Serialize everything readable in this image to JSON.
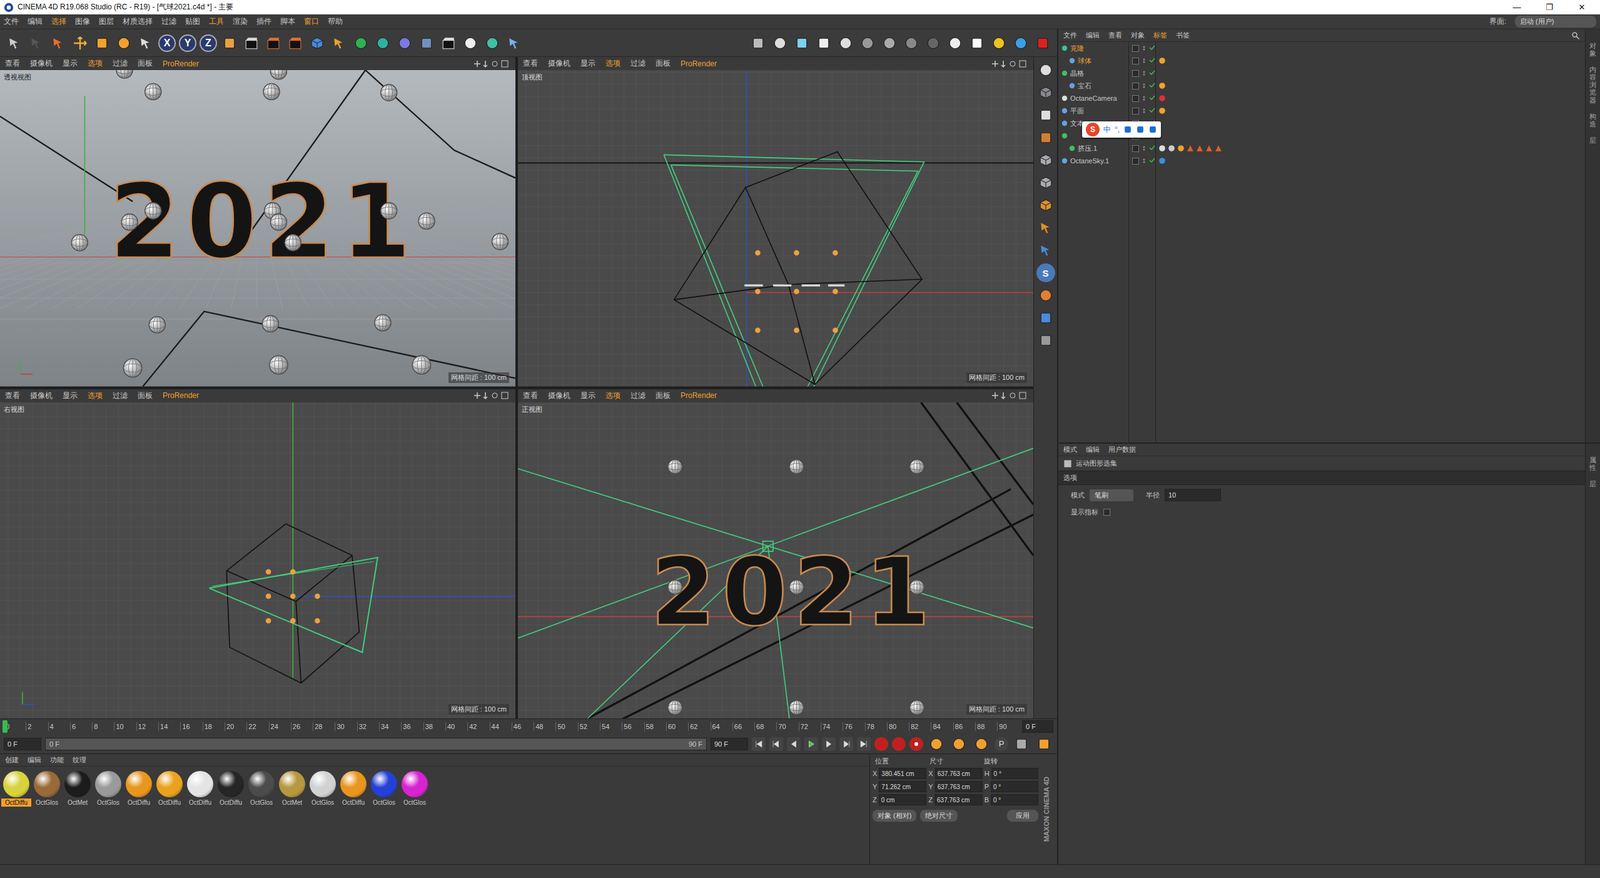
{
  "window": {
    "title": "CINEMA 4D R19.068 Studio (RC - R19) - [气球2021.c4d *] - 主要",
    "controls": [
      "—",
      "❐",
      "✕"
    ]
  },
  "menu": [
    {
      "label": "文件",
      "highlight": false
    },
    {
      "label": "编辑",
      "highlight": false
    },
    {
      "label": "选择",
      "highlight": true
    },
    {
      "label": "图像",
      "highlight": false
    },
    {
      "label": "图层",
      "highlight": false
    },
    {
      "label": "材质选择",
      "highlight": false
    },
    {
      "label": "过滤",
      "highlight": false
    },
    {
      "label": "贴图",
      "highlight": false
    },
    {
      "label": "工具",
      "highlight": true
    },
    {
      "label": "渲染",
      "highlight": false
    },
    {
      "label": "插件",
      "highlight": false
    },
    {
      "label": "脚本",
      "highlight": false
    },
    {
      "label": "窗口",
      "highlight": true
    },
    {
      "label": "帮助",
      "highlight": false
    }
  ],
  "layout": {
    "label": "界面:",
    "value": "启动 (用户)"
  },
  "toolbar": {
    "axes": [
      "X",
      "Y",
      "Z"
    ]
  },
  "viewport_menu": [
    {
      "label": "查看",
      "highlight": false
    },
    {
      "label": "摄像机",
      "highlight": false
    },
    {
      "label": "显示",
      "highlight": false
    },
    {
      "label": "选项",
      "highlight": true
    },
    {
      "label": "过滤",
      "highlight": false
    },
    {
      "label": "面板",
      "highlight": false
    },
    {
      "label": "ProRender",
      "highlight": true
    }
  ],
  "viewports": [
    {
      "name": "透视视图",
      "kind": "persp",
      "grid": "网格间距 : 100 cm"
    },
    {
      "name": "顶视图",
      "kind": "top",
      "grid": "网格间距 : 100 cm"
    },
    {
      "name": "右视图",
      "kind": "right",
      "grid": "网格间距 : 100 cm"
    },
    {
      "name": "正视图",
      "kind": "front",
      "grid": "网格间距 : 100 cm"
    }
  ],
  "scene": {
    "text": "2021"
  },
  "palette": {
    "letter": "S"
  },
  "timeline": {
    "ticks": [
      "0",
      "2",
      "4",
      "6",
      "8",
      "10",
      "12",
      "14",
      "16",
      "18",
      "20",
      "22",
      "24",
      "26",
      "28",
      "30",
      "32",
      "34",
      "36",
      "38",
      "40",
      "42",
      "44",
      "46",
      "48",
      "50",
      "52",
      "54",
      "56",
      "58",
      "60",
      "62",
      "64",
      "66",
      "68",
      "70",
      "72",
      "74",
      "76",
      "78",
      "80",
      "82",
      "84",
      "86",
      "88",
      "90"
    ],
    "current": "0 F",
    "level": 0,
    "start": "0 F",
    "slider_start": "0 F",
    "slider_end": "90 F",
    "end": "90 F"
  },
  "playback": {
    "keys": "P"
  },
  "materials": {
    "menu": [
      "创建",
      "编辑",
      "功能",
      "纹理"
    ],
    "items": [
      {
        "label": "OctDiffu",
        "color": "#d8d23c",
        "selected": true
      },
      {
        "label": "OctGlos",
        "color": "#9a6a38",
        "selected": false
      },
      {
        "label": "OctMet",
        "color": "#1c1c1c",
        "selected": false
      },
      {
        "label": "OctGlos",
        "color": "#9a9a9a",
        "selected": false
      },
      {
        "label": "OctDiffu",
        "color": "#e8961e",
        "selected": false
      },
      {
        "label": "OctDiffu",
        "color": "#eaa21e",
        "selected": false
      },
      {
        "label": "OctDiffu",
        "color": "#e4e4e4",
        "selected": false
      },
      {
        "label": "OctDiffu",
        "color": "#262626",
        "selected": false
      },
      {
        "label": "OctGlos",
        "color": "#4c4c4c",
        "selected": false
      },
      {
        "label": "OctMet",
        "color": "#b8983e",
        "selected": false
      },
      {
        "label": "OctGlos",
        "color": "#d2d2d2",
        "selected": false
      },
      {
        "label": "OctDiffu",
        "color": "#e8961e",
        "selected": false
      },
      {
        "label": "OctGlos",
        "color": "#2440d8",
        "selected": false
      },
      {
        "label": "OctGlos",
        "color": "#d824d0",
        "selected": false
      }
    ]
  },
  "coordinates": {
    "headers": [
      "位置",
      "尺寸",
      "旋转"
    ],
    "rows": [
      {
        "axis": "X",
        "pos": "380.451 cm",
        "saxis": "X",
        "size": "637.763 cm",
        "raxis": "H",
        "rot": "0 °"
      },
      {
        "axis": "Y",
        "pos": "71.262 cm",
        "saxis": "Y",
        "size": "637.763 cm",
        "raxis": "P",
        "rot": "0 °"
      },
      {
        "axis": "Z",
        "pos": "0 cm",
        "saxis": "Z",
        "size": "637.763 cm",
        "raxis": "B",
        "rot": "0 °"
      }
    ],
    "mode": "对象 (相对)",
    "size_mode": "绝对尺寸",
    "apply": "应用",
    "logo": "MAXON CINEMA 4D"
  },
  "objects": {
    "menu": [
      {
        "label": "文件",
        "highlight": false
      },
      {
        "label": "编辑",
        "highlight": false
      },
      {
        "label": "查看",
        "highlight": false
      },
      {
        "label": "对象",
        "highlight": false
      },
      {
        "label": "标签",
        "highlight": true
      },
      {
        "label": "书签",
        "highlight": false
      }
    ],
    "rows": [
      {
        "name": "克隆",
        "depth": 0,
        "kind": "cloner",
        "selected": true,
        "tags": []
      },
      {
        "name": "球体",
        "depth": 1,
        "kind": "sphere",
        "selected": true,
        "tags": [
          "material"
        ]
      },
      {
        "name": "晶格",
        "depth": 0,
        "kind": "lattice",
        "selected": false,
        "tags": []
      },
      {
        "name": "宝石",
        "depth": 1,
        "kind": "gem",
        "selected": false,
        "tags": [
          "material"
        ]
      },
      {
        "name": "OctaneCamera",
        "depth": 0,
        "kind": "camera",
        "selected": false,
        "tags": [
          "camera"
        ]
      },
      {
        "name": "平面",
        "depth": 0,
        "kind": "plane",
        "selected": false,
        "tags": [
          "material"
        ]
      },
      {
        "name": "文本",
        "depth": 0,
        "kind": "text",
        "selected": false,
        "tags": []
      },
      {
        "name": "",
        "depth": 0,
        "kind": "mograph",
        "selected": false,
        "tags": []
      },
      {
        "name": "挤压.1",
        "depth": 1,
        "kind": "extrude",
        "selected": false,
        "tags": [
          "phong",
          "checker",
          "material",
          "select",
          "select",
          "select",
          "select"
        ]
      },
      {
        "name": "OctaneSky.1",
        "depth": 0,
        "kind": "sky",
        "selected": false,
        "tags": [
          "sky"
        ]
      }
    ]
  },
  "ime": {
    "logo": "S",
    "items": [
      "中",
      "°,"
    ]
  },
  "side_tabs": [
    "对象",
    "内容浏览器",
    "构造",
    "层"
  ],
  "attributes": {
    "menu": [
      "模式",
      "编辑",
      "用户数据"
    ],
    "title": "运动图形选集",
    "tab": "选项",
    "fields": [
      {
        "label": "模式",
        "value": "笔刷",
        "kind": "dropdown"
      },
      {
        "label": "半径",
        "value": "10",
        "kind": "number"
      }
    ],
    "checkbox": {
      "label": "显示指标",
      "checked": false
    },
    "side_tabs": [
      "属性",
      "层"
    ]
  }
}
